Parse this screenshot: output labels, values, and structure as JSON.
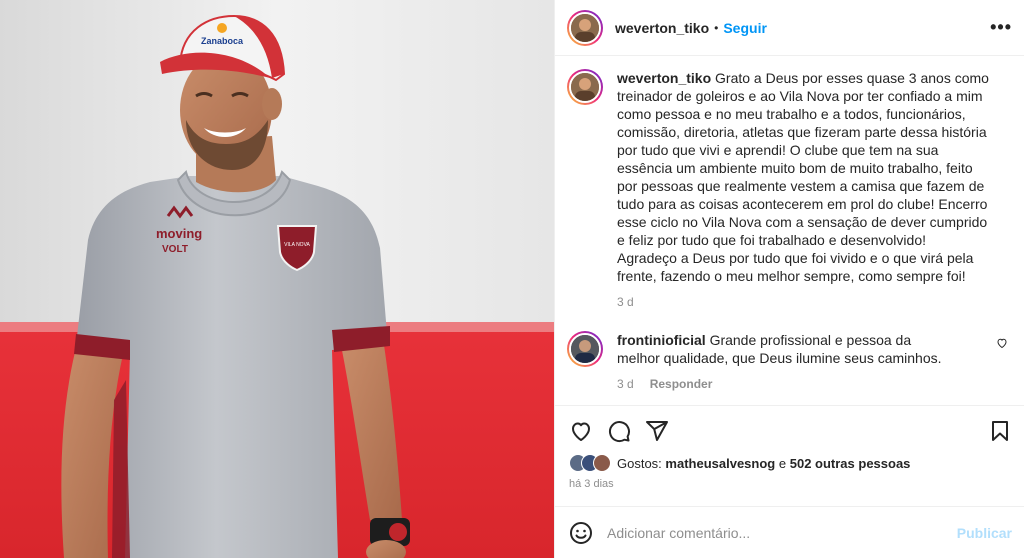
{
  "post": {
    "author": "weverton_tiko",
    "follow_label": "Seguir",
    "more_label": "•••",
    "separator": "•"
  },
  "photo": {
    "cap_text": "Zanaboca",
    "shirt_brand_1": "moving",
    "shirt_brand_2": "VOLT"
  },
  "caption": {
    "username": "weverton_tiko",
    "text": "Grato a Deus por esses quase 3 anos como treinador de goleiros e ao Vila Nova por ter confiado a mim como pessoa e no meu trabalho e a todos, funcionários, comissão, diretoria, atletas que fizeram parte dessa história por tudo que vivi e aprendi! O clube que tem na sua essência um ambiente muito bom de muito trabalho, feito por pessoas que realmente vestem a camisa que fazem de tudo para as coisas acontecerem em prol do clube! Encerro esse ciclo no Vila Nova com a sensação de dever cumprido e feliz por tudo que foi trabalhado e desenvolvido! Agradeço a Deus por tudo que foi vivido e o que virá pela frente, fazendo o meu melhor sempre, como sempre foi!",
    "time": "3 d"
  },
  "comments": [
    {
      "username": "frontinioficial",
      "text": "Grande profissional e pessoa da melhor qualidade, que Deus ilumine seus caminhos.",
      "time": "3 d",
      "reply_label": "Responder"
    }
  ],
  "likes": {
    "prefix": "Gostos:",
    "first_user": "matheusalvesnog",
    "connector": "e",
    "others": "502 outras pessoas"
  },
  "post_date": "há 3 dias",
  "add_comment": {
    "placeholder": "Adicionar comentário...",
    "post_label": "Publicar"
  },
  "colors": {
    "link_blue": "#0095f6",
    "post_disabled": "#b2dffc",
    "muted": "#8e8e8e",
    "text": "#262626",
    "wall_red": "#e8323a"
  },
  "icons": [
    "heart-icon",
    "comment-icon",
    "share-icon",
    "bookmark-icon",
    "emoji-icon",
    "more-icon"
  ]
}
